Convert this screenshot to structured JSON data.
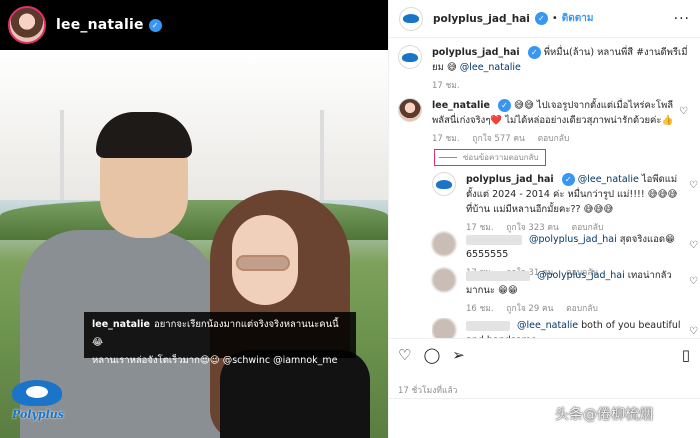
{
  "post_username": "lee_natalie",
  "caption": {
    "username": "lee_natalie",
    "line1": "อยากจะเรียกน้องมากแต่จริงจริงหลานนะคนนี้😂",
    "line2": "หลานเราหล่อจังโตเร็วมาก😍😉 @schwinc @iamnok_me"
  },
  "brand_logo_text": "Polyplus",
  "header": {
    "username": "polyplus_jad_hai",
    "separator": "•",
    "follow": "ติดตาม",
    "more": "···"
  },
  "comments": {
    "c1": {
      "username": "polyplus_jad_hai",
      "text": "พี่หมื่น(ล้าน) หลานพี่สี #งานดีพรีเมี่ยม 😅",
      "mention": "@lee_natalie",
      "time": "17 ชม."
    },
    "c2": {
      "username": "lee_natalie",
      "text": "😅😅 ไปเจอรูปจากตั้งแต่เมื่อไหร่คะโพลีพลัสนี่เก่งจริงๆ❤️ ไม่ได้หล่ออย่างเดียวสุภาพน่ารักด้วยค่ะ👍",
      "time": "17 ชม.",
      "likes": "ถูกใจ 577 คน",
      "reply": "ตอบกลับ"
    },
    "hide_replies": "ซ่อนข้อความตอบกลับ",
    "c3": {
      "username": "polyplus_jad_hai",
      "mention": "@lee_natalie",
      "text": "ไอพีดแม่ ตั้งแต่ 2024 - 2014 ค่ะ หมื่นกว่ารูป แม่!!!! 😅😅😅 ที่บ้าน แม่มีหลานอีกมั้ยคะ?? 😅😅😅",
      "time": "17 ชม.",
      "likes": "ถูกใจ 323 คน",
      "reply": "ตอบกลับ"
    },
    "c4": {
      "mention": "@polyplus_jad_hai",
      "text": "สุดจริงแอด😁6555555",
      "time": "17 ชม.",
      "likes": "ถูกใจ 31 คน",
      "reply": "ตอบกลับ"
    },
    "c5": {
      "mention": "@polyplus_jad_hai",
      "text": "เทอน่ากลัวมากนะ 😁😁",
      "time": "16 ชม.",
      "likes": "ถูกใจ 29 คน",
      "reply": "ตอบกลับ"
    },
    "c6": {
      "mention": "@lee_natalie",
      "text": "both of you beautiful and handsome"
    }
  },
  "actions": {
    "like": "♡",
    "comment": "◯",
    "share": "➢",
    "save": "▯"
  },
  "time_ago": "17 ชั่วโมงที่แล้ว",
  "watermark": "头条@倦柳梳烟"
}
